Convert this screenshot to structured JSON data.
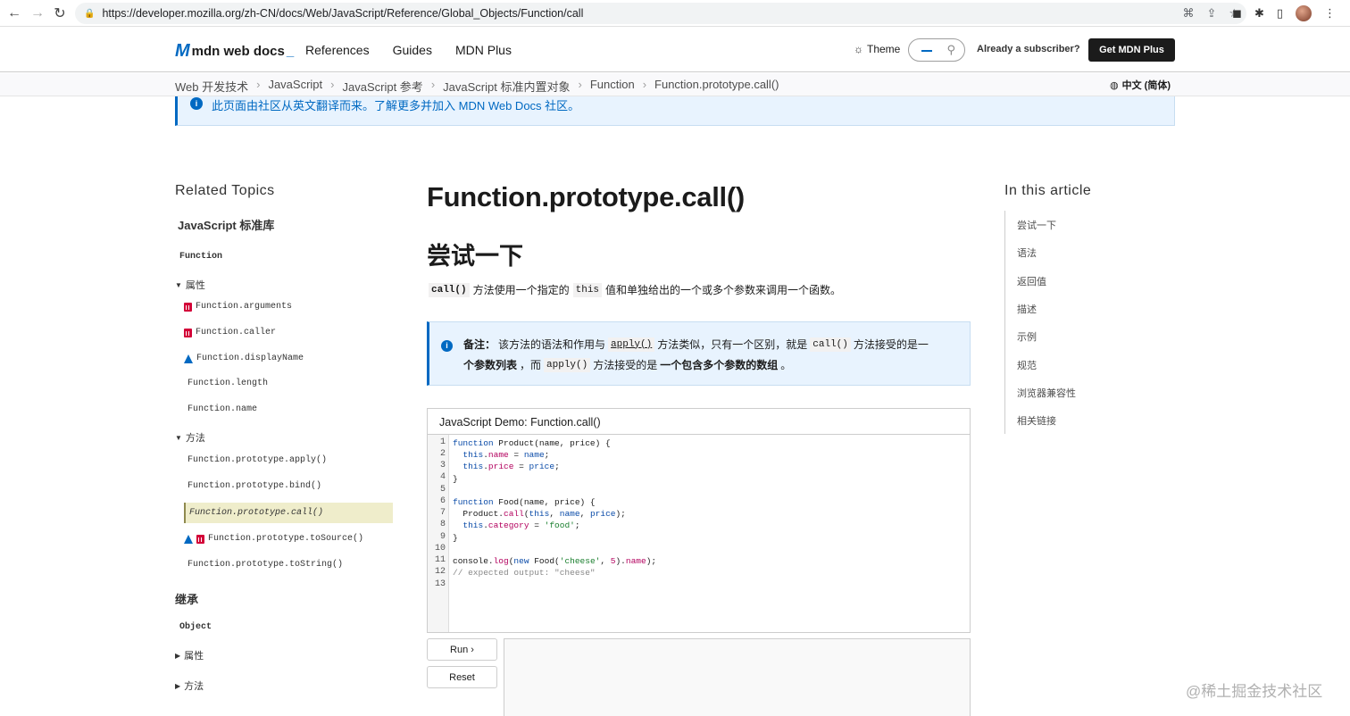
{
  "browser": {
    "url": "https://developer.mozilla.org/zh-CN/docs/Web/JavaScript/Reference/Global_Objects/Function/call"
  },
  "header": {
    "logo": "mdn web docs",
    "nav": [
      "References",
      "Guides",
      "MDN Plus"
    ],
    "theme": "Theme",
    "subscriber": "Already a subscriber?",
    "get_plus": "Get MDN Plus"
  },
  "breadcrumb": [
    "Web 开发技术",
    "JavaScript",
    "JavaScript 参考",
    "JavaScript 标准内置对象",
    "Function",
    "Function.prototype.call()"
  ],
  "language": "中文 (简体)",
  "notice": "此页面由社区从英文翻译而来。了解更多并加入 MDN Web Docs 社区。",
  "sidebar": {
    "title": "Related Topics",
    "subtitle": "JavaScript 标准库",
    "top_item": "Function",
    "group_props": "属性",
    "props": [
      "Function.arguments",
      "Function.caller",
      "Function.displayName",
      "Function.length",
      "Function.name"
    ],
    "group_methods": "方法",
    "methods": [
      "Function.prototype.apply()",
      "Function.prototype.bind()",
      "Function.prototype.call()",
      "Function.prototype.toSource()",
      "Function.prototype.toString()"
    ],
    "inherit_heading": "继承",
    "inherit_item": "Object",
    "inherit_props": "属性",
    "inherit_methods": "方法"
  },
  "main": {
    "title": "Function.prototype.call()",
    "section": "尝试一下",
    "intro_code1": "call()",
    "intro_text1": "方法使用一个指定的",
    "intro_code2": "this",
    "intro_text2": "值和单独给出的一个或多个参数来调用一个函数。",
    "note": {
      "label": "备注：",
      "t1": "该方法的语法和作用与",
      "c1": "apply()",
      "t2": "方法类似，只有一个区别，就是",
      "c2": "call()",
      "t3": "方法接受的是一",
      "t4": "个参数列表",
      "t5": "，而",
      "c3": "apply()",
      "t6": "方法接受的是",
      "t7": "一个包含多个参数的数组",
      "t8": "。"
    },
    "demo_title": "JavaScript Demo: Function.call()",
    "line_numbers": [
      "1",
      "2",
      "3",
      "4",
      "5",
      "6",
      "7",
      "8",
      "9",
      "10",
      "11",
      "12",
      "13"
    ],
    "run": "Run ›",
    "reset": "Reset"
  },
  "toc": {
    "title": "In this article",
    "items": [
      "尝试一下",
      "语法",
      "返回值",
      "描述",
      "示例",
      "规范",
      "浏览器兼容性",
      "相关链接"
    ]
  },
  "watermark": "@稀土掘金技术社区"
}
